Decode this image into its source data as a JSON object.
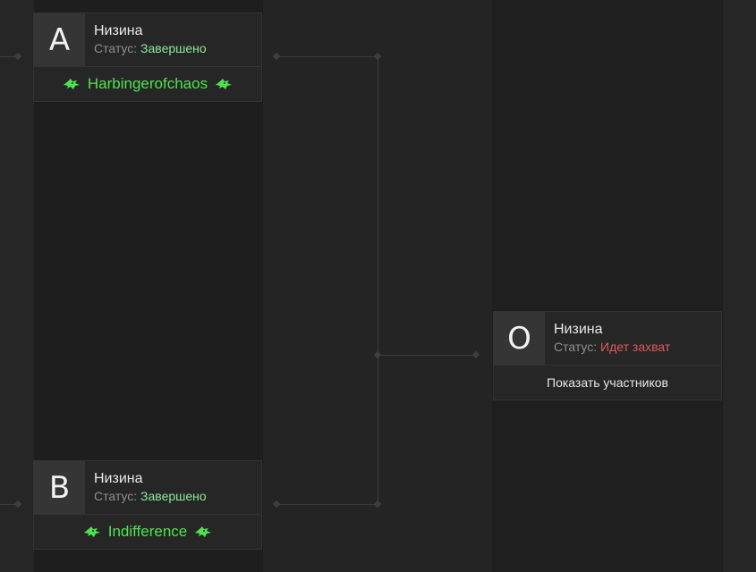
{
  "matches": [
    {
      "letter": "A",
      "map": "Низина",
      "status_label": "Статус:",
      "status_value": "Завершено",
      "team": "Harbingerofchaos"
    },
    {
      "letter": "B",
      "map": "Низина",
      "status_label": "Статус:",
      "status_value": "Завершено",
      "team": "Indifference"
    },
    {
      "letter": "O",
      "map": "Низина",
      "status_label": "Статус:",
      "status_value": "Идет захват",
      "action": "Показать участников"
    }
  ],
  "colors": {
    "status_done": "#8ce89a",
    "status_capture": "#e05a5a",
    "team": "#4ee34e"
  },
  "icons": [
    "dragon-head-icon"
  ]
}
